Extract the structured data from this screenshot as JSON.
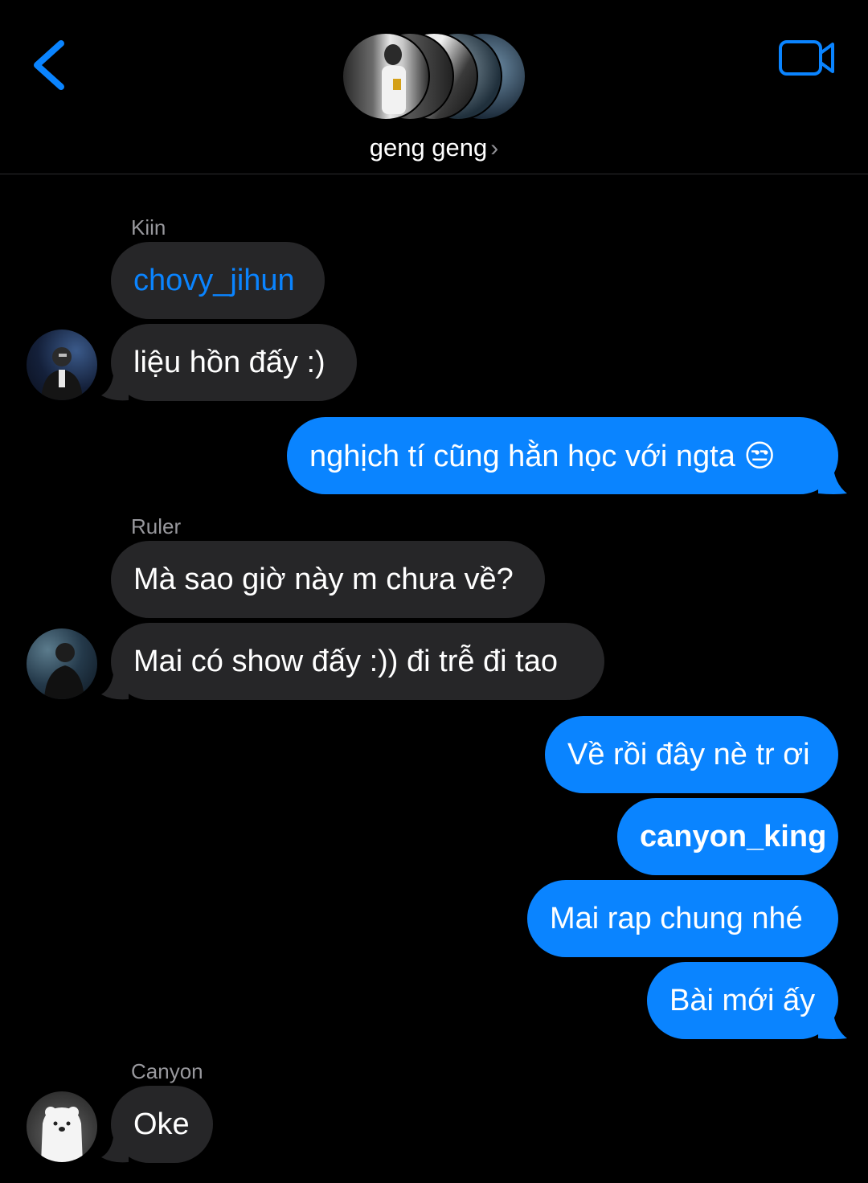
{
  "header": {
    "back_icon": "chevron-left-icon",
    "video_icon": "video-camera-icon",
    "group_name": "geng geng",
    "chevron": "›",
    "accent_color": "#0a84ff"
  },
  "messages": [
    {
      "sender": "Kiin",
      "side": "in",
      "text": "chovy_jihun",
      "mention": true
    },
    {
      "side": "in",
      "text": "liệu hồn đấy :)",
      "avatar": "player-photo-avatar"
    },
    {
      "side": "out",
      "text": "nghịch tí cũng hằn học với ngta 😒"
    },
    {
      "sender": "Ruler",
      "side": "in",
      "text": "Mà sao giờ này m chưa về?"
    },
    {
      "side": "in",
      "text": "Mai có show đấy :)) đi trễ đi tao",
      "avatar": "player-photo-avatar"
    },
    {
      "side": "out",
      "text": "Về rồi đây nè tr ơi"
    },
    {
      "side": "out",
      "text": "canyon_king",
      "mention": true
    },
    {
      "side": "out",
      "text": "Mai rap chung nhé"
    },
    {
      "side": "out",
      "text": "Bài mới ấy"
    },
    {
      "sender": "Canyon",
      "side": "in",
      "text": "Oke",
      "avatar": "polar-bear-avatar"
    }
  ]
}
